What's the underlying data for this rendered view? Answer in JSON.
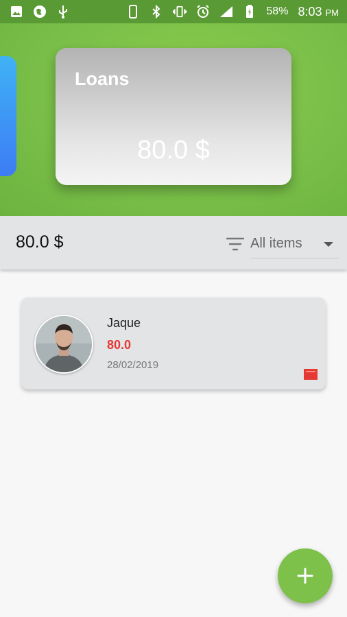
{
  "status_bar": {
    "battery_percent": "58%",
    "time": "8:03",
    "ampm": "PM",
    "left_icons": [
      "image-icon",
      "location-globe-icon",
      "usb-icon"
    ],
    "right_icons": [
      "phone-icon",
      "bluetooth-icon",
      "vibrate-icon",
      "alarm-icon",
      "signal-icon",
      "battery-icon"
    ]
  },
  "hero": {
    "card": {
      "title": "Loans",
      "amount": "80.0 $"
    }
  },
  "summary": {
    "total": "80.0 $",
    "filter": {
      "icon": "filter-icon",
      "label": "All items"
    }
  },
  "items": [
    {
      "name": "Jaque",
      "amount": "80.0",
      "date": "28/02/2019",
      "flag_icon": "red-flag-icon"
    }
  ],
  "fab": {
    "label": "+"
  },
  "colors": {
    "status_bar": "#5a9a34",
    "hero_green": "#7cc14a",
    "side_card_blue": "#3d7cf5",
    "amount_red": "#e53935",
    "fab_green": "#7dc14b"
  }
}
